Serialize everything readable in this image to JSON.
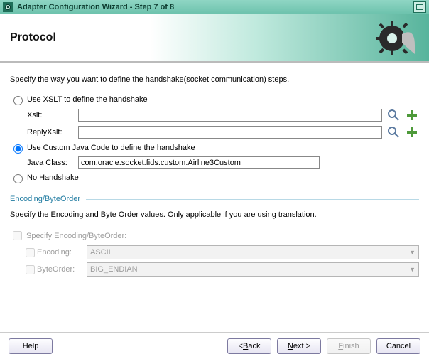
{
  "window": {
    "title": "Adapter Configuration Wizard - Step 7 of 8"
  },
  "banner": {
    "heading": "Protocol"
  },
  "handshake": {
    "instruction": "Specify the way you want to define the handshake(socket communication) steps.",
    "options": {
      "xslt": {
        "label": "Use XSLT to define the handshake",
        "fields": {
          "xslt": {
            "label": "Xslt:",
            "value": ""
          },
          "reply": {
            "label": "ReplyXslt:",
            "value": ""
          }
        }
      },
      "java": {
        "label": "Use Custom Java Code to define the handshake",
        "field": {
          "label": "Java Class:",
          "value": "com.oracle.socket.fids.custom.Airline3Custom"
        }
      },
      "none": {
        "label": "No Handshake"
      }
    }
  },
  "encoding": {
    "section_label": "Encoding/ByteOrder",
    "instruction": "Specify the Encoding and Byte Order values. Only applicable if you are using translation.",
    "specify_label": "Specify Encoding/ByteOrder:",
    "fields": {
      "encoding": {
        "label": "Encoding:",
        "value": "ASCII"
      },
      "byteorder": {
        "label": "ByteOrder:",
        "value": "BIG_ENDIAN"
      }
    }
  },
  "footer": {
    "help": "Help",
    "back_prefix": "< ",
    "back_u": "B",
    "back_rest": "ack",
    "next_u": "N",
    "next_rest": "ext >",
    "finish_u": "F",
    "finish_rest": "inish",
    "cancel": "Cancel"
  },
  "icons": {
    "search": "search-icon",
    "plus": "plus-icon"
  }
}
